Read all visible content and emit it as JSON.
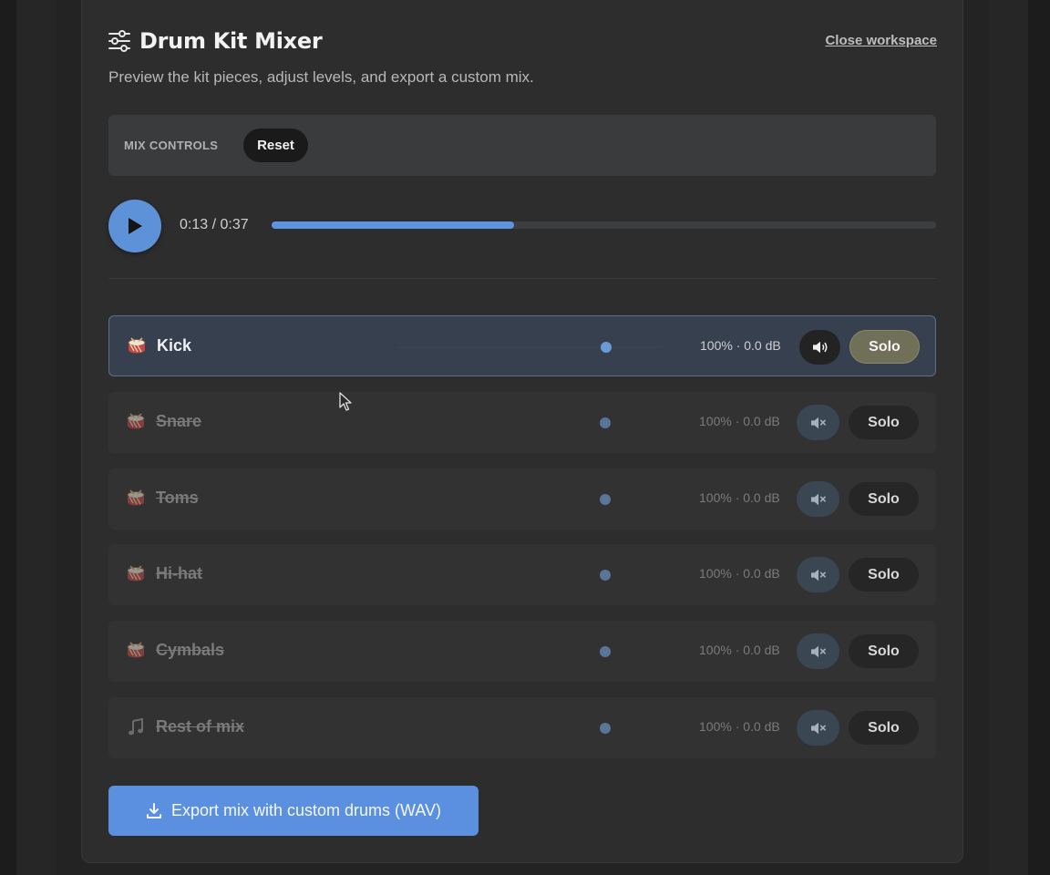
{
  "header": {
    "title": "Drum Kit Mixer",
    "close_label": "Close workspace",
    "subtitle": "Preview the kit pieces, adjust levels, and export a custom mix.",
    "icon": "sliders-icon"
  },
  "mix_controls": {
    "label": "MIX CONTROLS",
    "reset_label": "Reset"
  },
  "player": {
    "time": "0:13 / 0:37",
    "progress": 0.365
  },
  "tracks": [
    {
      "name": "Kick",
      "icon": "drum-icon",
      "level": "100% · 0.0 dB",
      "solo_label": "Solo",
      "muted": false,
      "volume": 0.79
    },
    {
      "name": "Snare",
      "icon": "drum-icon",
      "level": "100% · 0.0 dB",
      "solo_label": "Solo",
      "muted": true,
      "volume": 0.79
    },
    {
      "name": "Toms",
      "icon": "drum-icon",
      "level": "100% · 0.0 dB",
      "solo_label": "Solo",
      "muted": true,
      "volume": 0.79
    },
    {
      "name": "Hi-hat",
      "icon": "drum-icon",
      "level": "100% · 0.0 dB",
      "solo_label": "Solo",
      "muted": true,
      "volume": 0.79
    },
    {
      "name": "Cymbals",
      "icon": "drum-icon",
      "level": "100% · 0.0 dB",
      "solo_label": "Solo",
      "muted": true,
      "volume": 0.79
    },
    {
      "name": "Rest of mix",
      "icon": "music-note-icon",
      "level": "100% · 0.0 dB",
      "solo_label": "Solo",
      "muted": true,
      "volume": 0.79
    }
  ],
  "export": {
    "label": "Export mix with custom drums (WAV)"
  },
  "colors": {
    "accent": "#5b8fe0",
    "panel": "#2d2d2d",
    "solo_active": "#706f57"
  }
}
